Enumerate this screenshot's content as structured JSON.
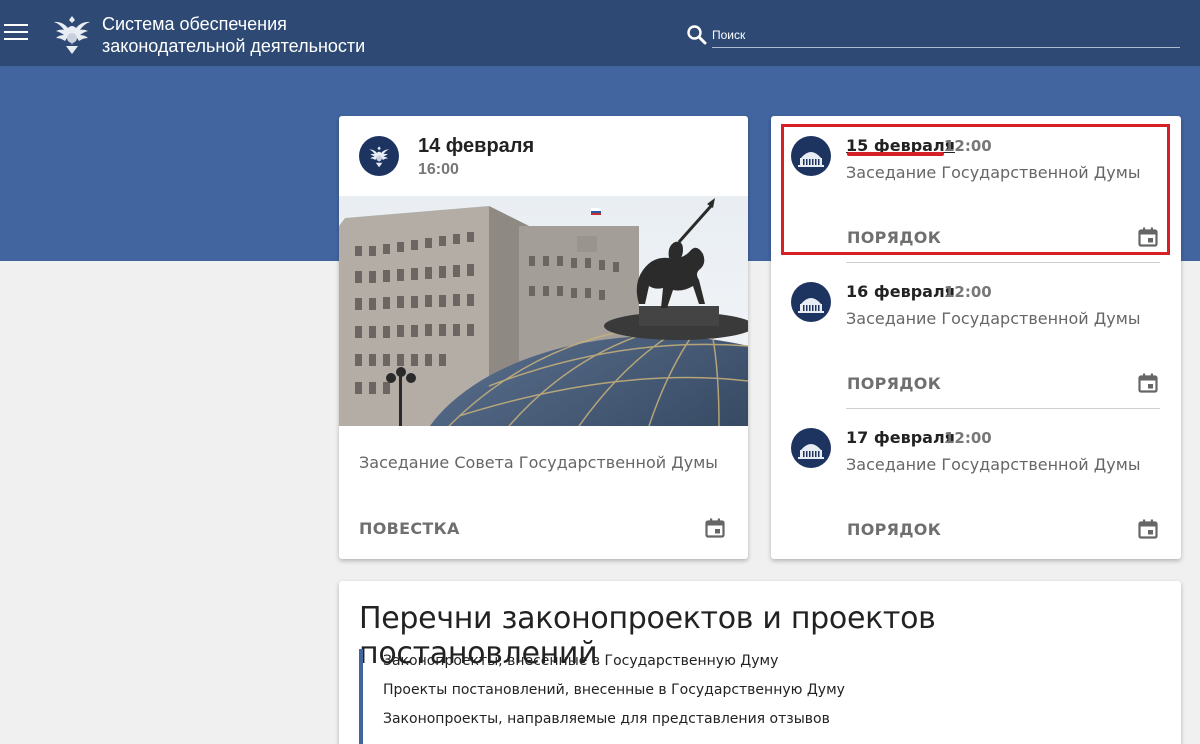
{
  "header": {
    "title_line1": "Система обеспечения",
    "title_line2": "законодательной деятельности",
    "search_placeholder": "Поиск"
  },
  "council_card": {
    "date": "14 февраля",
    "time": "16:00",
    "description": "Заседание Совета Государственной Думы",
    "action": "ПОВЕСТКА"
  },
  "plenary_card": {
    "events": [
      {
        "date": "15 февраля",
        "time": "12:00",
        "description": "Заседание Государственной Думы",
        "action": "ПОРЯДОК"
      },
      {
        "date": "16 февраля",
        "time": "12:00",
        "description": "Заседание Государственной Думы",
        "action": "ПОРЯДОК"
      },
      {
        "date": "17 февраля",
        "time": "12:00",
        "description": "Заседание Государственной Думы",
        "action": "ПОРЯДОК"
      }
    ]
  },
  "lists": {
    "title": "Перечни законопроектов и проектов постановлений",
    "items": [
      "Законопроекты, внесенные в Государственную Думу",
      "Проекты постановлений, внесенные в Государственную Думу",
      "Законопроекты, направляемые для представления отзывов"
    ]
  },
  "colors": {
    "header_bg": "#2e4a74",
    "hero_bg": "#4265a0",
    "highlight": "#d62027"
  },
  "icons": [
    "menu-icon",
    "emblem-icon",
    "search-icon",
    "calendar-icon",
    "duma-building-icon"
  ]
}
